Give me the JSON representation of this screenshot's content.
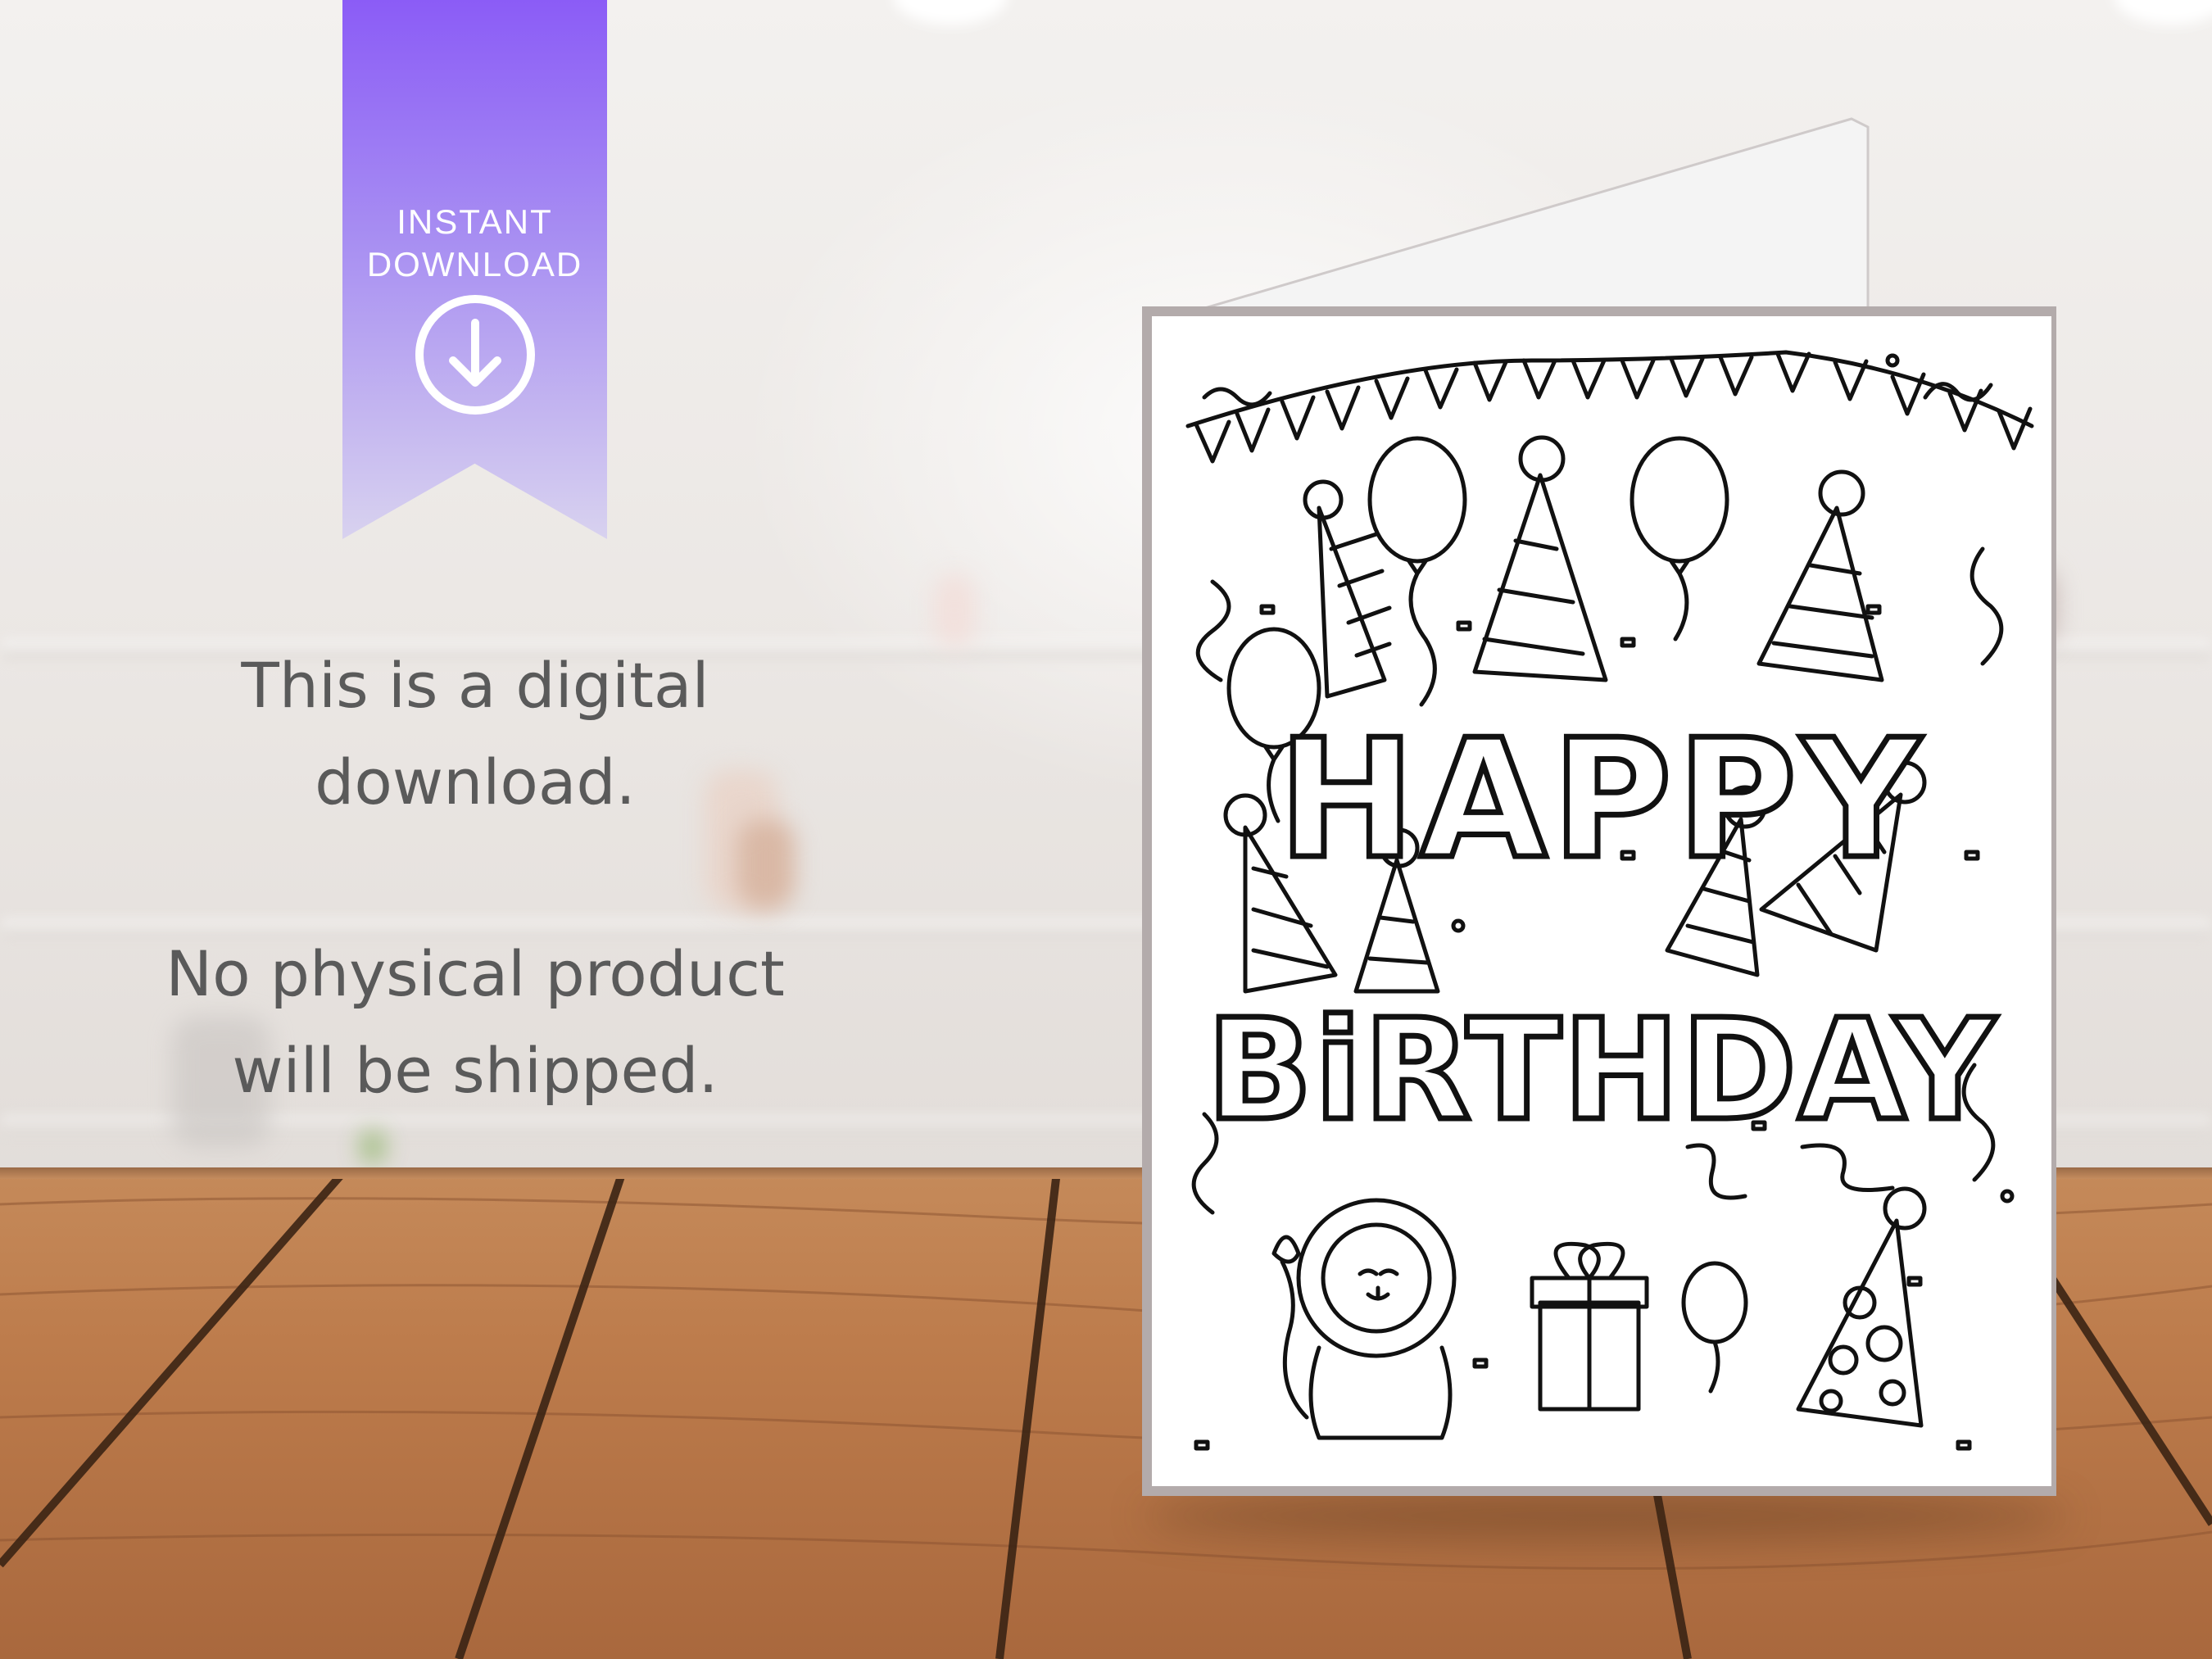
{
  "badge": {
    "line1": "INSTANT",
    "line2": "DOWNLOAD",
    "icon": "download-arrow-icon",
    "color_top": "#8b5cf6",
    "color_bottom": "#d8d2ef"
  },
  "notice": {
    "line1": "This is a digital",
    "line2": "download.",
    "line3": "No physical product",
    "line4": "will be shipped."
  },
  "card": {
    "word1": "HAPPY",
    "word2": "BiRTHDAY"
  }
}
